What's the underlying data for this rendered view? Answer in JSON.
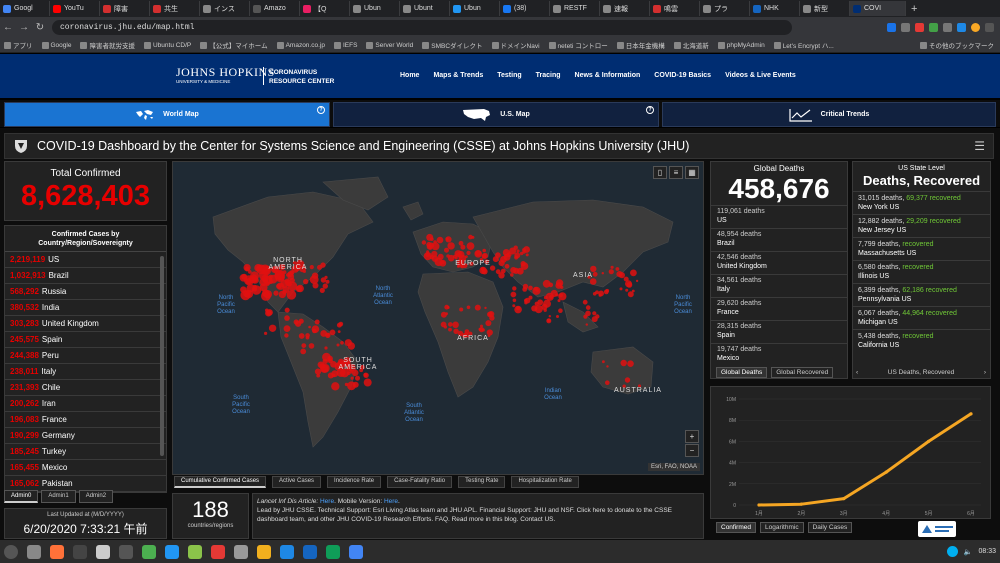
{
  "browser": {
    "tabs": [
      {
        "label": "Googl",
        "color": "#4285f4"
      },
      {
        "label": "YouTu",
        "color": "#ff0000"
      },
      {
        "label": "障害",
        "color": "#d32f2f"
      },
      {
        "label": "共生",
        "color": "#d32f2f"
      },
      {
        "label": "インス",
        "color": "#888888"
      },
      {
        "label": "Amazo",
        "color": "#555555"
      },
      {
        "label": "【Q",
        "color": "#e91e63"
      },
      {
        "label": "Ubun",
        "color": "#888888"
      },
      {
        "label": "Ubunt",
        "color": "#888888"
      },
      {
        "label": "Ubun",
        "color": "#2196f3"
      },
      {
        "label": "(38)",
        "color": "#1877f2"
      },
      {
        "label": "RESTF",
        "color": "#888888"
      },
      {
        "label": "速報",
        "color": "#888888"
      },
      {
        "label": "鳴雲",
        "color": "#d32f2f"
      },
      {
        "label": "プラ",
        "color": "#888888"
      },
      {
        "label": "NHK",
        "color": "#1565c0"
      },
      {
        "label": "新型",
        "color": "#888888"
      },
      {
        "label": "COVI",
        "color": "#002d72",
        "active": true
      }
    ],
    "url": "coronavirus.jhu.edu/map.html",
    "bookmarks": [
      "アプリ",
      "Google",
      "障害者就労支援",
      "Ubuntu CD/P",
      "【公式】マイホーム",
      "Amazon.co.jp",
      "IEFS",
      "Server World",
      "SMBCダイレクト",
      "ドメインNavi",
      "neteti コントロー",
      "日本年金機構",
      "北海道新",
      "phpMyAdmin",
      "Let's Encrypt ハ..."
    ],
    "bookmarks_right": "その他のブックマーク"
  },
  "site": {
    "logo_line1": "JOHNS HOPKINS",
    "logo_line2": "UNIVERSITY & MEDICINE",
    "logo_right1": "CORONAVIRUS",
    "logo_right2": "RESOURCE CENTER",
    "nav": [
      "Home",
      "Maps & Trends",
      "Testing",
      "Tracing",
      "News & Information",
      "COVID-19 Basics",
      "Videos & Live Events"
    ]
  },
  "modes": {
    "world": "World Map",
    "us": "U.S. Map",
    "trends": "Critical Trends"
  },
  "dashboard": {
    "title": "COVID-19 Dashboard by the Center for Systems Science and Engineering (CSSE) at Johns Hopkins University (JHU)",
    "total_confirmed_label": "Total Confirmed",
    "total_confirmed": "8,628,403",
    "list_header_1": "Confirmed Cases by",
    "list_header_2": "Country/Region/Sovereignty",
    "countries": [
      {
        "count": "2,219,119",
        "name": "US"
      },
      {
        "count": "1,032,913",
        "name": "Brazil"
      },
      {
        "count": "568,292",
        "name": "Russia"
      },
      {
        "count": "380,532",
        "name": "India"
      },
      {
        "count": "303,283",
        "name": "United Kingdom"
      },
      {
        "count": "245,575",
        "name": "Spain"
      },
      {
        "count": "244,388",
        "name": "Peru"
      },
      {
        "count": "238,011",
        "name": "Italy"
      },
      {
        "count": "231,393",
        "name": "Chile"
      },
      {
        "count": "200,262",
        "name": "Iran"
      },
      {
        "count": "196,083",
        "name": "France"
      },
      {
        "count": "190,299",
        "name": "Germany"
      },
      {
        "count": "185,245",
        "name": "Turkey"
      },
      {
        "count": "165,455",
        "name": "Mexico"
      },
      {
        "count": "165,062",
        "name": "Pakistan"
      }
    ],
    "admin_tabs": [
      "Admin0",
      "Admin1",
      "Admin2"
    ],
    "last_updated_label": "Last Updated at (M/D/YYYY)",
    "last_updated": "6/20/2020 7:33:21 午前",
    "map_labels": {
      "north_america": "NORTH\nAMERICA",
      "south_america": "SOUTH\nAMERICA",
      "europe": "EUROPE",
      "asia": "ASIA",
      "africa": "AFRICA",
      "australia": "AUSTRALIA",
      "north_pacific_w": "North\nPacific\nOcean",
      "north_atlantic": "North\nAtlantic\nOcean",
      "north_pacific_e": "North\nPacific\nOcean",
      "south_pacific": "South\nPacific\nOcean",
      "south_atlantic": "South\nAtlantic\nOcean",
      "indian": "Indian\nOcean"
    },
    "map_attribution": "Esri, FAO, NOAA",
    "map_tabs": [
      "Cumulative Confirmed Cases",
      "Active Cases",
      "Incidence Rate",
      "Case-Fatality Ratio",
      "Testing Rate",
      "Hospitalization Rate"
    ],
    "country_count": "188",
    "country_count_label": "countries/regions",
    "info_text": {
      "line1_pre": "Lancet Inf Dis Article: ",
      "line1_link1": "Here",
      "line1_mid": ". Mobile Version: ",
      "line1_link2": "Here",
      "line1_end": ".",
      "line2": "Lead by JHU CSSE. Technical Support: Esri Living Atlas team and JHU APL. Financial Support: JHU and NSF. Click here to donate to the CSSE dashboard team, and other JHU COVID-19 Research Efforts. FAQ. Read more in this blog. Contact US."
    },
    "global_deaths_label": "Global Deaths",
    "global_deaths": "458,676",
    "deaths": [
      {
        "count": "119,061 deaths",
        "name": "US"
      },
      {
        "count": "48,954 deaths",
        "name": "Brazil"
      },
      {
        "count": "42,546 deaths",
        "name": "United Kingdom"
      },
      {
        "count": "34,561 deaths",
        "name": "Italy"
      },
      {
        "count": "29,620 deaths",
        "name": "France"
      },
      {
        "count": "28,315 deaths",
        "name": "Spain"
      },
      {
        "count": "19,747 deaths",
        "name": "Mexico"
      }
    ],
    "deaths_tabs": [
      "Global Deaths",
      "Global Recovered"
    ],
    "us_state_label": "US State Level",
    "us_state_title": "Deaths, Recovered",
    "states": [
      {
        "deaths": "31,015 deaths,",
        "recovered": "69,377 recovered",
        "name": "New York US"
      },
      {
        "deaths": "12,882 deaths,",
        "recovered": "29,209 recovered",
        "name": "New Jersey US"
      },
      {
        "deaths": "7,799 deaths,",
        "recovered": "recovered",
        "name": "Massachusetts US"
      },
      {
        "deaths": "6,580 deaths,",
        "recovered": "recovered",
        "name": "Illinois US"
      },
      {
        "deaths": "6,399 deaths,",
        "recovered": "62,186 recovered",
        "name": "Pennsylvania US"
      },
      {
        "deaths": "6,067 deaths,",
        "recovered": "44,964 recovered",
        "name": "Michigan US"
      },
      {
        "deaths": "5,438 deaths,",
        "recovered": "recovered",
        "name": "California US"
      }
    ],
    "us_nav_label": "US Deaths, Recovered",
    "chart_tabs": [
      "Confirmed",
      "Logarithmic",
      "Daily Cases"
    ]
  },
  "chart_data": {
    "type": "line",
    "x": [
      "1月",
      "2月",
      "3月",
      "4月",
      "5月",
      "6月"
    ],
    "values": [
      0,
      0.08,
      0.6,
      3.1,
      6.0,
      8.6
    ],
    "y_ticks": [
      "10M",
      "8M",
      "6M",
      "4M",
      "2M",
      "0"
    ],
    "ylim": [
      0,
      10
    ],
    "series_color": "#f5a623"
  },
  "taskbar": {
    "time": "08:33",
    "apps": [
      "#888888",
      "#ff7139",
      "#444444",
      "#cccccc",
      "#555555",
      "#4caf50",
      "#2196f3",
      "#8bc34a",
      "#e53935",
      "#999999",
      "#f2b01e",
      "#1e88e5",
      "#1565c0",
      "#0f9d58",
      "#4285f4"
    ]
  }
}
